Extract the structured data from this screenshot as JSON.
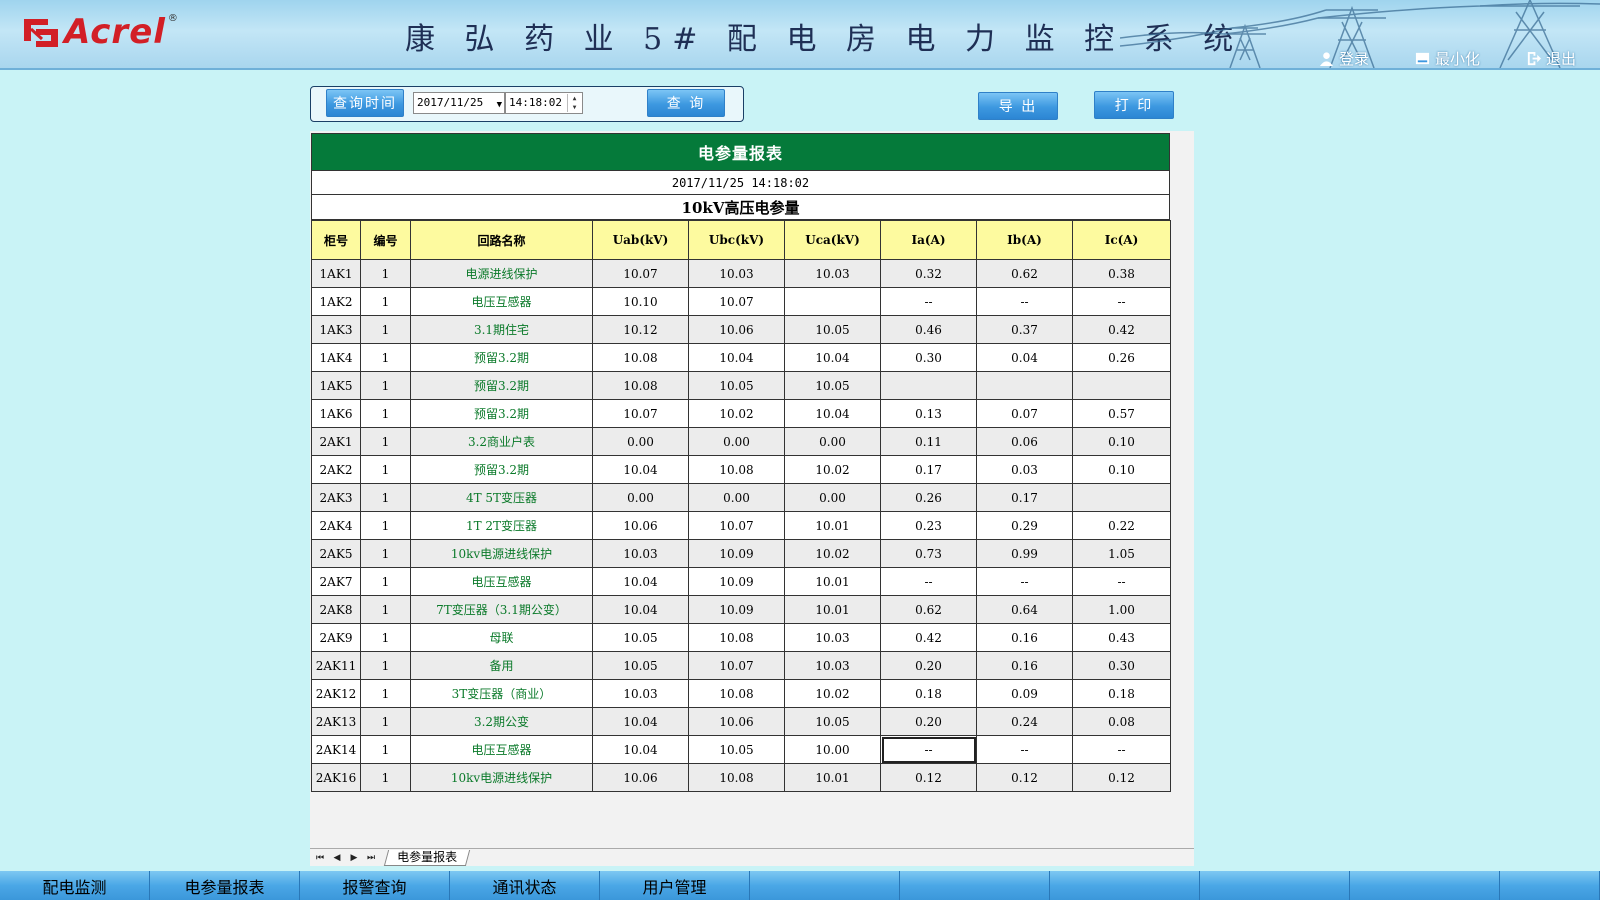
{
  "header": {
    "brand": "Acrel",
    "registered": "®",
    "title": "康 弘 药 业 5# 配 电 房 电 力 监 控 系 统",
    "buttons": [
      {
        "label": "登录",
        "icon": "user-icon"
      },
      {
        "label": "最小化",
        "icon": "minimize-icon"
      },
      {
        "label": "退出",
        "icon": "exit-icon"
      }
    ]
  },
  "toolbar": {
    "query_time_label": "查询时间",
    "date_value": "2017/11/25",
    "time_value": "14:18:02",
    "query_button": "查 询",
    "export_button": "导 出",
    "print_button": "打 印"
  },
  "report": {
    "title": "电参量报表",
    "datetime": "2017/11/25  14:18:02",
    "subtitle": "10kV高压电参量",
    "columns": [
      "柜号",
      "编号",
      "回路名称",
      "Uab(kV)",
      "Ubc(kV)",
      "Uca(kV)",
      "Ia(A)",
      "Ib(A)",
      "Ic(A)"
    ],
    "rows": [
      [
        "1AK1",
        "1",
        "电源进线保护",
        "10.07",
        "10.03",
        "10.03",
        "0.32",
        "0.62",
        "0.38"
      ],
      [
        "1AK2",
        "1",
        "电压互感器",
        "10.10",
        "10.07",
        "",
        "--",
        "--",
        "--"
      ],
      [
        "1AK3",
        "1",
        "3.1期住宅",
        "10.12",
        "10.06",
        "10.05",
        "0.46",
        "0.37",
        "0.42"
      ],
      [
        "1AK4",
        "1",
        "预留3.2期",
        "10.08",
        "10.04",
        "10.04",
        "0.30",
        "0.04",
        "0.26"
      ],
      [
        "1AK5",
        "1",
        "预留3.2期",
        "10.08",
        "10.05",
        "10.05",
        "",
        "",
        ""
      ],
      [
        "1AK6",
        "1",
        "预留3.2期",
        "10.07",
        "10.02",
        "10.04",
        "0.13",
        "0.07",
        "0.57"
      ],
      [
        "2AK1",
        "1",
        "3.2商业户表",
        "0.00",
        "0.00",
        "0.00",
        "0.11",
        "0.06",
        "0.10"
      ],
      [
        "2AK2",
        "1",
        "预留3.2期",
        "10.04",
        "10.08",
        "10.02",
        "0.17",
        "0.03",
        "0.10"
      ],
      [
        "2AK3",
        "1",
        "4T 5T变压器",
        "0.00",
        "0.00",
        "0.00",
        "0.26",
        "0.17",
        ""
      ],
      [
        "2AK4",
        "1",
        "1T 2T变压器",
        "10.06",
        "10.07",
        "10.01",
        "0.23",
        "0.29",
        "0.22"
      ],
      [
        "2AK5",
        "1",
        "10kv电源进线保护",
        "10.03",
        "10.09",
        "10.02",
        "0.73",
        "0.99",
        "1.05"
      ],
      [
        "2AK7",
        "1",
        "电压互感器",
        "10.04",
        "10.09",
        "10.01",
        "--",
        "--",
        "--"
      ],
      [
        "2AK8",
        "1",
        "7T变压器（3.1期公变）",
        "10.04",
        "10.09",
        "10.01",
        "0.62",
        "0.64",
        "1.00"
      ],
      [
        "2AK9",
        "1",
        "母联",
        "10.05",
        "10.08",
        "10.03",
        "0.42",
        "0.16",
        "0.43"
      ],
      [
        "2AK11",
        "1",
        "备用",
        "10.05",
        "10.07",
        "10.03",
        "0.20",
        "0.16",
        "0.30"
      ],
      [
        "2AK12",
        "1",
        "3T变压器（商业）",
        "10.03",
        "10.08",
        "10.02",
        "0.18",
        "0.09",
        "0.18"
      ],
      [
        "2AK13",
        "1",
        "3.2期公变",
        "10.04",
        "10.06",
        "10.05",
        "0.20",
        "0.24",
        "0.08"
      ],
      [
        "2AK14",
        "1",
        "电压互感器",
        "10.04",
        "10.05",
        "10.00",
        "--",
        "--",
        "--"
      ],
      [
        "2AK16",
        "1",
        "10kv电源进线保护",
        "10.06",
        "10.08",
        "10.01",
        "0.12",
        "0.12",
        "0.12"
      ]
    ]
  },
  "sheet_tabs": [
    "电参量报表"
  ],
  "bottom_nav": [
    "配电监测",
    "电参量报表",
    "报警查询",
    "通讯状态",
    "用户管理",
    "",
    "",
    "",
    "",
    "",
    ""
  ],
  "colors": {
    "background": "#c9f3f6",
    "title_bar": "#057a3a",
    "header_row": "#fdfa9f",
    "circuit_name": "#0b7a2a",
    "brand_red": "#d21f26",
    "button_blue": "#3d98e0"
  }
}
